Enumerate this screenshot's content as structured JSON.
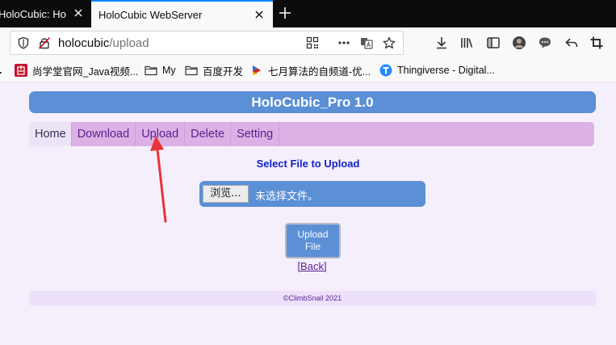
{
  "browser": {
    "tabs": [
      {
        "title": "HoloCubic: HoloCubic WebServer",
        "active": false
      },
      {
        "title": "HoloCubic WebServer",
        "active": true
      }
    ],
    "url": {
      "host": "holocubic",
      "path": "/upload"
    },
    "bookmarks": [
      {
        "label": "尚学堂官网_Java视频...",
        "icon": "shangxuetang-icon"
      },
      {
        "label": "My",
        "icon": "folder-icon"
      },
      {
        "label": "百度开发",
        "icon": "folder-icon"
      },
      {
        "label": "七月算法的自频道-优...",
        "icon": "youku-icon"
      },
      {
        "label": "Thingiverse - Digital...",
        "icon": "thingiverse-icon"
      }
    ],
    "colors": {
      "tab_strip": "#0c0c0d",
      "active_tab_accent": "#0a84ff"
    }
  },
  "page": {
    "banner_title": "HoloCubic_Pro 1.0",
    "menu": [
      {
        "label": "Home",
        "active": true
      },
      {
        "label": "Download",
        "active": false
      },
      {
        "label": "Upload",
        "active": false
      },
      {
        "label": "Delete",
        "active": false
      },
      {
        "label": "Setting",
        "active": false
      }
    ],
    "select_title": "Select File to Upload",
    "file_input": {
      "button_label": "浏览...",
      "status": "未选择文件。"
    },
    "upload_button": {
      "line1": "Upload",
      "line2": "File"
    },
    "back_link": "[Back]",
    "footer": "©ClimbSnail 2021",
    "colors": {
      "banner": "#5b8fd6",
      "menu": "#dcb1e5",
      "background": "#f5effc",
      "title_text": "#0f1fc9",
      "annotation_arrow": "#e8343a"
    }
  }
}
